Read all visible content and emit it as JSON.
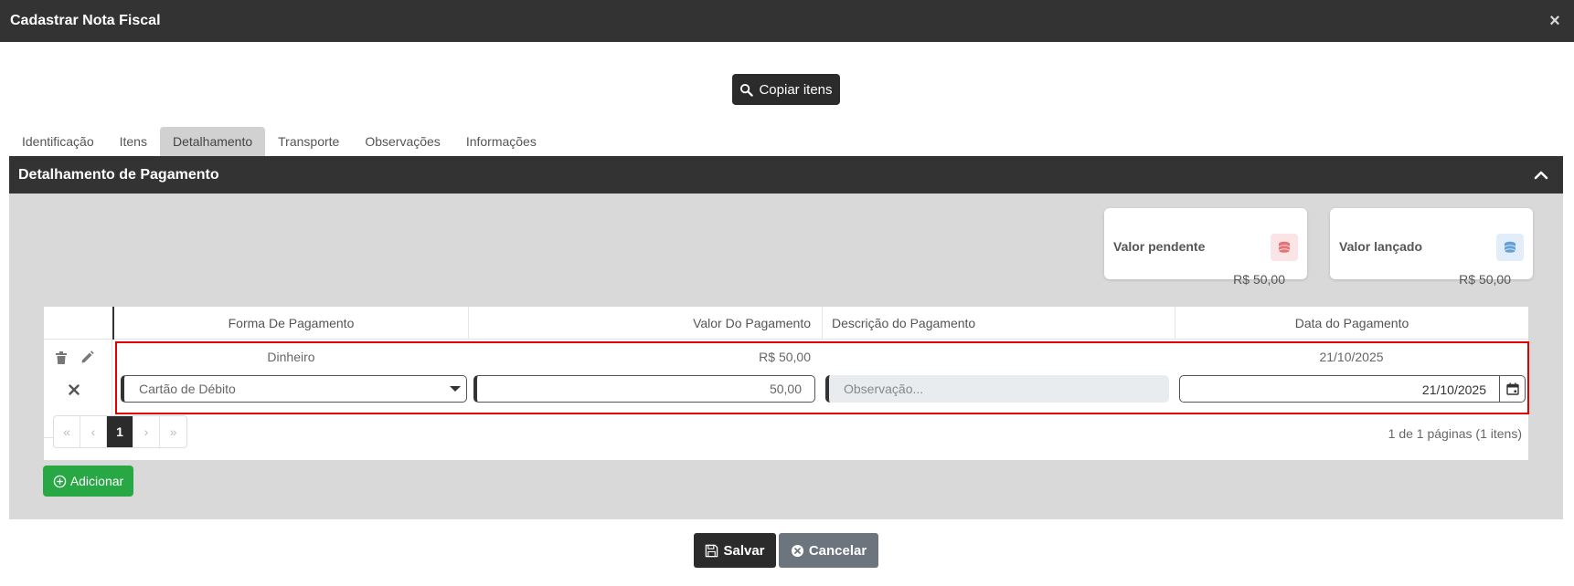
{
  "window": {
    "title": "Cadastrar Nota Fiscal",
    "close_glyph": "×"
  },
  "toolbar": {
    "copy_label": "Copiar itens"
  },
  "tabs": [
    {
      "label": "Identificação"
    },
    {
      "label": "Itens"
    },
    {
      "label": "Detalhamento",
      "active": true
    },
    {
      "label": "Transporte"
    },
    {
      "label": "Observações"
    },
    {
      "label": "Informações"
    }
  ],
  "panel": {
    "title": "Detalhamento de Pagamento"
  },
  "cards": {
    "pending": {
      "label": "Valor pendente",
      "value": "R$ 50,00",
      "icon": "coins-icon",
      "color": "#e57373"
    },
    "posted": {
      "label": "Valor lançado",
      "value": "R$ 50,00",
      "icon": "coins-icon",
      "color": "#64a0d8"
    }
  },
  "table": {
    "columns": [
      "Forma De Pagamento",
      "Valor Do Pagamento",
      "Descrição do Pagamento",
      "Data do Pagamento"
    ],
    "rows": [
      {
        "forma": "Dinheiro",
        "valor": "R$ 50,00",
        "descricao": "",
        "data": "21/10/2025"
      }
    ],
    "edit_row": {
      "forma": "Cartão de Débito",
      "valor": "50,00",
      "descricao_placeholder": "Observação...",
      "data": "21/10/2025"
    }
  },
  "pager": {
    "first": "«",
    "prev": "‹",
    "current": "1",
    "next": "›",
    "last": "»",
    "info": "1 de 1 páginas (1 itens)"
  },
  "actions": {
    "add_label": "Adicionar",
    "save_label": "Salvar",
    "cancel_label": "Cancelar"
  },
  "colors": {
    "dark": "#333333",
    "success": "#28a745",
    "secondary": "#6c757d",
    "highlight": "#e00000"
  }
}
